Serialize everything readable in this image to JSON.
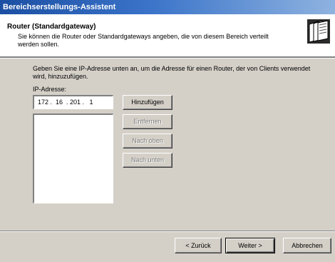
{
  "window": {
    "title": "Bereichserstellungs-Assistent"
  },
  "header": {
    "title": "Router (Standardgateway)",
    "subtitle": "Sie können die Router oder Standardgateways angeben, die von diesem Bereich verteilt werden sollen.",
    "icon": "wizard-pages-icon"
  },
  "body": {
    "intro": "Geben Sie eine IP-Adresse unten an, um die Adresse für einen Router, der von Clients verwendet wird, hinzuzufügen.",
    "ip_label": "IP-Adresse:",
    "ip_value": "172 .  16  . 201 .   1",
    "router_list": []
  },
  "side_buttons": {
    "add": "Hinzufügen",
    "remove": "Entfernen",
    "move_up": "Nach oben",
    "move_down": "Nach unten"
  },
  "nav_buttons": {
    "back": "< Zurück",
    "next": "Weiter >",
    "cancel": "Abbrechen"
  }
}
